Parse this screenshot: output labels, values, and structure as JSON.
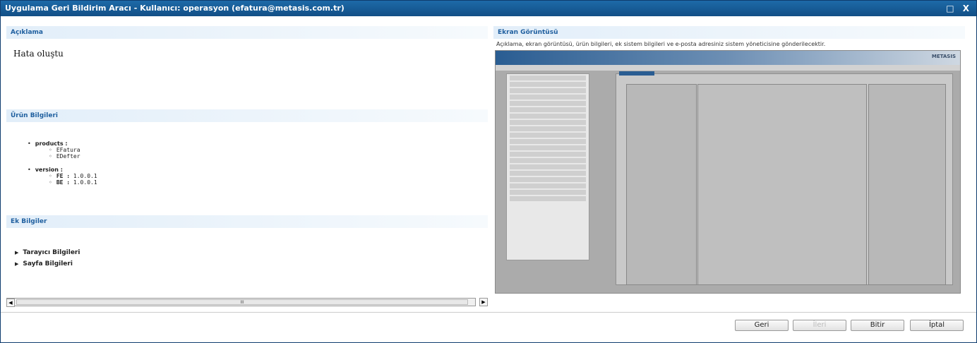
{
  "window": {
    "title": "Uygulama Geri Bildirim Aracı - Kullanıcı: operasyon (efatura@metasis.com.tr)",
    "controls": "□ X"
  },
  "left": {
    "aciklama_header": "Açıklama",
    "aciklama_text": "Hata oluştu",
    "urun_header": "Ürün Bilgileri",
    "products_label": "products :",
    "products": [
      "EFatura",
      "EDefter"
    ],
    "version_label": "version :",
    "versions": [
      {
        "key": "FE :",
        "value": "1.0.0.1"
      },
      {
        "key": "BE :",
        "value": "1.0.0.1"
      }
    ],
    "ek_header": "Ek Bilgiler",
    "ek_items": [
      "Tarayıcı Bilgileri",
      "Sayfa Bilgileri"
    ],
    "scroll_thumb": "III"
  },
  "right": {
    "header": "Ekran Görüntüsü",
    "subtitle": "Açıklama, ekran görüntüsü, ürün bilgileri, ek sistem bilgileri ve e-posta adresiniz sistem yöneticisine gönderilecektir.",
    "logo_text": "METASIS"
  },
  "footer": {
    "geri": "Geri",
    "ileri": "İleri",
    "bitir": "Bitir",
    "iptal": "İptal"
  }
}
